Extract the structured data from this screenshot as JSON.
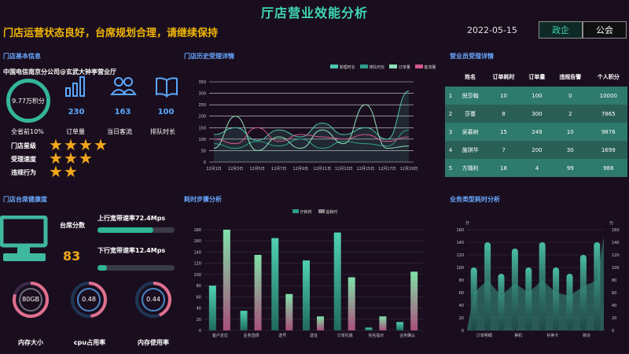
{
  "header": {
    "title": "厅店营业效能分析",
    "slogan": "门店运营状态良好，台席规划合理，请继续保持",
    "date": "2022-05-15",
    "tabs": [
      "政企",
      "公会"
    ]
  },
  "store_info": {
    "title": "门店基本信息",
    "store_name": "中国电信南京分公司@玄武大钟亭营业厅",
    "score": "9.77万积分",
    "rank_label": "全省前10%",
    "stats": [
      {
        "value": "230",
        "label": "订单量",
        "icon": "bar-chart-icon"
      },
      {
        "value": "163",
        "label": "当日客流",
        "icon": "people-icon"
      },
      {
        "value": "100",
        "label": "排队时长",
        "icon": "book-icon"
      }
    ],
    "ratings": [
      {
        "label": "门店星级",
        "stars": 4
      },
      {
        "label": "受理速度",
        "stars": 3
      },
      {
        "label": "违规行为",
        "stars": 2
      }
    ]
  },
  "history": {
    "title": "门店历史受理详情",
    "legend": [
      "受理时长",
      "排队时长",
      "订单量",
      "客流量"
    ],
    "colors": [
      "#4fc3b0",
      "#2f9e8c",
      "#8fe0b8",
      "#d4588a"
    ]
  },
  "staff": {
    "title": "营业员受理详情",
    "headers": [
      "姓名",
      "订单耗时",
      "订单量",
      "违规告警",
      "个人积分"
    ],
    "rows": [
      [
        "1",
        "倪莎翰",
        "10",
        "100",
        "0",
        "10000"
      ],
      [
        "2",
        "莎蔓",
        "8",
        "300",
        "2",
        "7865"
      ],
      [
        "3",
        "吴慕树",
        "15",
        "249",
        "10",
        "9876"
      ],
      [
        "4",
        "施琪华",
        "7",
        "200",
        "30",
        "1699"
      ],
      [
        "5",
        "方璐利",
        "18",
        "4",
        "99",
        "988"
      ]
    ]
  },
  "health": {
    "title": "门店台席健康度",
    "score_label": "台席分数",
    "score": "83",
    "up_label": "上行宽带速率72.4Mps",
    "up_fraction": 0.72,
    "down_label": "下行宽带速率12.4Mps",
    "down_fraction": 0.12,
    "gauges": [
      {
        "value": "80GB",
        "label": "内存大小",
        "fraction": 0.8
      },
      {
        "value": "0.48",
        "label": "cpu占用率",
        "fraction": 0.48
      },
      {
        "value": "0.44",
        "label": "内存使用率",
        "fraction": 0.44
      }
    ]
  },
  "steps": {
    "title": "耗时步骤分析",
    "legend": [
      "厅耗时",
      "监耗时"
    ]
  },
  "biz": {
    "title": "业务类型耗时分析",
    "y_left_unit": "分",
    "y_right_unit": "元"
  },
  "chart_data": [
    {
      "type": "line",
      "x": [
        "12月1日",
        "12月3日",
        "12月5日",
        "12月7日",
        "12月9日",
        "12月11日",
        "12月13日",
        "12月15日",
        "12月17日",
        "12月19日"
      ],
      "ylim": [
        0,
        350
      ],
      "yticks": [
        0,
        50,
        100,
        150,
        200,
        250,
        300,
        350
      ],
      "series": [
        {
          "name": "受理时长",
          "values": [
            120,
            150,
            95,
            140,
            110,
            170,
            120,
            150,
            100,
            310
          ]
        },
        {
          "name": "排队时长",
          "values": [
            80,
            60,
            90,
            70,
            100,
            60,
            90,
            80,
            70,
            140
          ]
        },
        {
          "name": "订单量",
          "values": [
            60,
            200,
            50,
            110,
            60,
            140,
            80,
            250,
            60,
            70
          ]
        },
        {
          "name": "客流量",
          "values": [
            100,
            80,
            150,
            90,
            120,
            110,
            100,
            120,
            90,
            110
          ]
        }
      ]
    },
    {
      "type": "bar",
      "categories": [
        "客户定位",
        "业务选择",
        "选号",
        "选址",
        "订单托底",
        "实名指示",
        "业务确认"
      ],
      "ylim": [
        0,
        180
      ],
      "yticks": [
        0,
        20,
        40,
        60,
        80,
        100,
        120,
        140,
        160,
        180
      ],
      "series": [
        {
          "name": "厅耗时",
          "values": [
            80,
            35,
            165,
            125,
            175,
            5,
            15
          ]
        },
        {
          "name": "监耗时",
          "values": [
            180,
            135,
            65,
            25,
            95,
            25,
            105
          ]
        }
      ]
    },
    {
      "type": "bar",
      "categories": [
        "订单明细",
        "换机",
        "补换卡",
        "新办"
      ],
      "ylim": [
        0,
        160
      ],
      "yticks": [
        0,
        20,
        40,
        60,
        80,
        100,
        120,
        140,
        160
      ],
      "series": [
        {
          "values": [
            100,
            140,
            90,
            130,
            100,
            140,
            100,
            90,
            120,
            140
          ]
        }
      ]
    }
  ]
}
